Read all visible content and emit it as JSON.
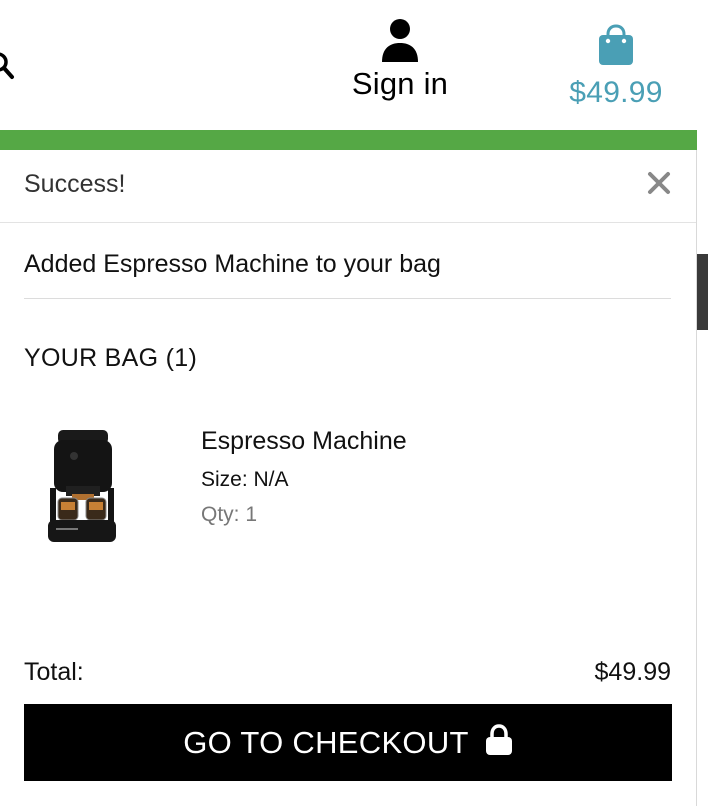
{
  "header": {
    "signin_label": "Sign in",
    "bag_total": "$49.99",
    "icons": {
      "search": "search-icon",
      "user": "user-icon",
      "bag": "shopping-bag-icon"
    }
  },
  "colors": {
    "success_bar": "#55a845",
    "bag_accent": "#4a9fb5",
    "checkout_bg": "#000000",
    "checkout_text": "#ffffff",
    "qty_text": "#777777"
  },
  "toast": {
    "title": "Success!",
    "close_icon": "close-icon",
    "message": "Added Espresso Machine to your bag",
    "bag_heading": "YOUR BAG (1)",
    "items": [
      {
        "name": "Espresso Machine",
        "size": "Size: N/A",
        "qty": "Qty: 1",
        "image": "espresso-machine-image"
      }
    ],
    "total_label": "Total:",
    "total_value": "$49.99",
    "checkout_label": "GO TO CHECKOUT",
    "checkout_icon": "lock-icon"
  }
}
